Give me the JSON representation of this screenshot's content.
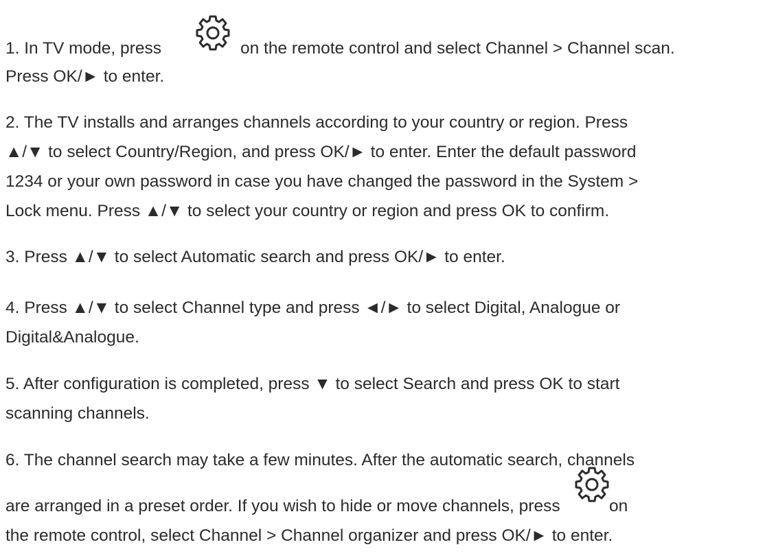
{
  "icons": {
    "settings": "gear-icon"
  },
  "steps": [
    {
      "line1_a": "1. In TV mode, press",
      "line1_b": "on the remote control and select Channel > Channel scan.",
      "line2": "Press OK/► to enter."
    },
    {
      "line1": "2. The TV installs and arranges channels according to your country or region. Press",
      "line2": "▲/▼ to select Country/Region, and press OK/► to enter. Enter the default password",
      "line3": "1234 or your own password in case you have changed the password in the System >",
      "line4": "Lock menu. Press ▲/▼ to select your country or region and press OK to confirm."
    },
    {
      "line1": "3. Press ▲/▼ to select Automatic search and press OK/► to enter."
    },
    {
      "line1": "4. Press ▲/▼ to select Channel type and press ◄/► to select Digital, Analogue or",
      "line2": "Digital&Analogue."
    },
    {
      "line1": "5. After configuration is completed, press ▼ to select Search and press OK to start",
      "line2": "scanning channels."
    },
    {
      "line1": "6. The channel search may take a few minutes. After the automatic search, channels",
      "line2_a": "are arranged in a preset order. If you wish to hide or move channels, press",
      "line2_b": "on",
      "line3": "the remote control, select Channel > Channel organizer and press OK/► to enter."
    }
  ]
}
